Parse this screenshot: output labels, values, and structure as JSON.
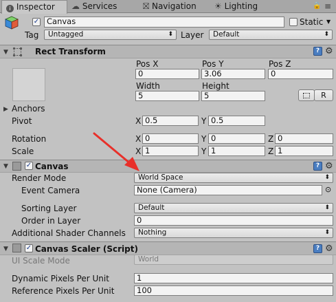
{
  "tabs": [
    {
      "label": "Inspector",
      "icon": "info-icon"
    },
    {
      "label": "Services",
      "icon": "cloud-icon"
    },
    {
      "label": "Navigation",
      "icon": "navigation-icon"
    },
    {
      "label": "Lighting",
      "icon": "lighting-icon"
    }
  ],
  "header": {
    "name": "Canvas",
    "static_label": "Static",
    "tag_label": "Tag",
    "tag_value": "Untagged",
    "layer_label": "Layer",
    "layer_value": "Default"
  },
  "rect_transform": {
    "title": "Rect Transform",
    "pos_x_label": "Pos X",
    "pos_y_label": "Pos Y",
    "pos_z_label": "Pos Z",
    "pos_x": "0",
    "pos_y": "3.06",
    "pos_z": "0",
    "width_label": "Width",
    "height_label": "Height",
    "width": "5",
    "height": "5",
    "r_button": "R",
    "anchors_label": "Anchors",
    "pivot_label": "Pivot",
    "pivot_x": "0.5",
    "pivot_y": "0.5",
    "rotation_label": "Rotation",
    "rot_x": "0",
    "rot_y": "0",
    "rot_z": "0",
    "scale_label": "Scale",
    "scale_x": "1",
    "scale_y": "1",
    "scale_z": "1",
    "x": "X",
    "y": "Y",
    "z": "Z"
  },
  "canvas": {
    "title": "Canvas",
    "render_mode_label": "Render Mode",
    "render_mode_value": "World Space",
    "event_camera_label": "Event Camera",
    "event_camera_value": "None (Camera)",
    "sorting_layer_label": "Sorting Layer",
    "sorting_layer_value": "Default",
    "order_label": "Order in Layer",
    "order_value": "0",
    "shader_label": "Additional Shader Channels",
    "shader_value": "Nothing"
  },
  "scaler": {
    "title": "Canvas Scaler (Script)",
    "ui_scale_label": "UI Scale Mode",
    "ui_scale_value": "World",
    "dynamic_label": "Dynamic Pixels Per Unit",
    "dynamic_value": "1",
    "reference_label": "Reference Pixels Per Unit",
    "reference_value": "100"
  },
  "colors": {
    "annotation_arrow": "#e8302a",
    "help_icon": "#4a7ec1",
    "tab_bar": "#a7a7a7"
  }
}
